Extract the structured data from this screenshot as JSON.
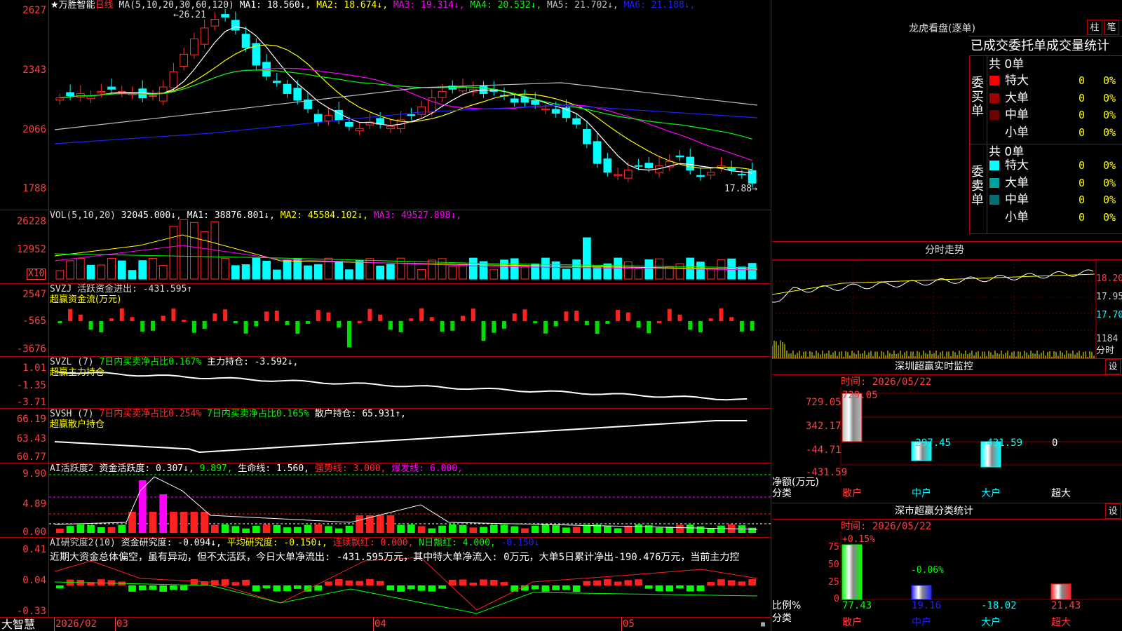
{
  "kline": {
    "stock_name": "★万胜智能",
    "period": "日线",
    "ma_label": "MA(5,10,20,30,60,120)",
    "ma_values": [
      {
        "name": "MA1:",
        "value": "18.560↓",
        "color": "#ffffff"
      },
      {
        "name": "MA2:",
        "value": "18.674↓",
        "color": "#ffff00"
      },
      {
        "name": "MA3:",
        "value": "19.314↓",
        "color": "#ff00ff"
      },
      {
        "name": "MA4:",
        "value": "20.532↓",
        "color": "#00ff00"
      },
      {
        "name": "MA5:",
        "value": "21.702↓",
        "color": "#c0c0c0"
      },
      {
        "name": "MA6:",
        "value": "21.188↓",
        "color": "#2020ff"
      }
    ],
    "axis": [
      "2627",
      "2343",
      "2066",
      "1788"
    ],
    "high_label": "26.21",
    "low_label": "17.88"
  },
  "vol": {
    "label": "VOL(5,10,20)",
    "value": "32045.000↓",
    "mas": [
      {
        "name": "MA1:",
        "value": "38876.801↓",
        "color": "#ffffff"
      },
      {
        "name": "MA2:",
        "value": "45584.102↓",
        "color": "#ffff00"
      },
      {
        "name": "MA3:",
        "value": "49527.898↓",
        "color": "#ff00ff"
      }
    ],
    "axis": [
      "26228",
      "12952"
    ],
    "unit": "X10"
  },
  "svzj": {
    "line1": "SVZJ  活跃资金进出: -431.595↑",
    "line2": "超赢资金流(万元)",
    "axis": [
      "2547",
      "-565",
      "-3676"
    ]
  },
  "svzl": {
    "label": "SVZL (7)",
    "part1": "7日内买卖净占比0.167%",
    "part2": "主力持仓: -3.592↓,",
    "line2": "超赢主力持仓",
    "axis": [
      "1.01",
      "-1.35",
      "-3.71"
    ]
  },
  "svsh": {
    "label": "SVSH (7)",
    "part1": "7日内买卖净占比0.254%",
    "part2": "7日内买卖净占比0.165%",
    "part3": "散户持仓: 65.931↑,",
    "line2": "超赢散户持仓",
    "axis": [
      "66.19",
      "63.43",
      "60.77"
    ]
  },
  "ai1": {
    "label": "AI活跃度2",
    "part1": "资金活跃度: 0.307↓,",
    "part2": "9.897,",
    "part3": "生命线: 1.560,",
    "part4": "强势线: 3.000,",
    "part5": "爆发线: 6.000,",
    "axis": [
      "9.90",
      "4.89",
      "0.00"
    ]
  },
  "ai2": {
    "label": "AI研究度2(10)",
    "part1": "资金研究度: -0.094↓,",
    "part2": "平均研究度: -0.150↓,",
    "part3": "连续飘红: 0.000,",
    "part4": "N日飘红: 4.000,",
    "part5": "-0.150↓",
    "comment": "近期大资金总体偏空，虽有异动，但不太活跃，今日大单净流出: -431.595万元，其中特大单净流入: 0万元，大单5日累计净出-190.476万元，当前主力控",
    "axis": [
      "0.41",
      "0.04",
      "-0.33"
    ]
  },
  "bottom": {
    "brand": "大智慧",
    "dates": [
      "2026/02",
      "03",
      "04",
      "05"
    ]
  },
  "lhb": {
    "title": "龙虎看盘(逐单)",
    "btn1": "柱",
    "btn2": "笔",
    "subtitle": "已成交委托单成交量统计",
    "buy_label": "委买单",
    "sell_label": "委卖单",
    "buy_total": "共 0单",
    "sell_total": "共 0单",
    "buy_rows": [
      {
        "name": "特大",
        "count": "0",
        "pct": "0%",
        "color": "#ff0000"
      },
      {
        "name": "大单",
        "count": "0",
        "pct": "0%",
        "color": "#a00000"
      },
      {
        "name": "中单",
        "count": "0",
        "pct": "0%",
        "color": "#700000"
      },
      {
        "name": "小单",
        "count": "0",
        "pct": "0%",
        "color": "#000000"
      }
    ],
    "sell_rows": [
      {
        "name": "特大",
        "count": "0",
        "pct": "0%",
        "color": "#00ffff"
      },
      {
        "name": "大单",
        "count": "0",
        "pct": "0%",
        "color": "#00a0a0"
      },
      {
        "name": "中单",
        "count": "0",
        "pct": "0%",
        "color": "#007070"
      },
      {
        "name": "小单",
        "count": "0",
        "pct": "0%",
        "color": "#000000"
      }
    ]
  },
  "intraday": {
    "title": "分时走势",
    "axis": [
      "18.20",
      "17.95",
      "17.70"
    ],
    "vol_label": "1184",
    "time_label": "分时"
  },
  "monitor": {
    "title": "深圳超赢实时监控",
    "set_label": "设",
    "time": "时间: 2026/05/22",
    "axis": [
      "729.05",
      "342.17",
      "-44.71",
      "-431.59"
    ],
    "top_value": "729.05",
    "unit": "净额(万元)",
    "cat_label": "分类",
    "categories": [
      "散户",
      "中户",
      "大户",
      "超大"
    ],
    "values": [
      "-297.45",
      "-431.59",
      "0"
    ]
  },
  "classify": {
    "title": "深市超赢分类统计",
    "set_label": "设",
    "time": "时间: 2026/05/22",
    "axis": [
      "75",
      "50",
      "25",
      "0"
    ],
    "top_pct": "+0.15%",
    "second_pct": "-0.06%",
    "unit": "比例%",
    "cat_label": "分类",
    "categories": [
      "散户",
      "中户",
      "大户",
      "超大"
    ],
    "values": [
      "77.43",
      "19.16",
      "-18.02",
      "21.43"
    ]
  }
}
